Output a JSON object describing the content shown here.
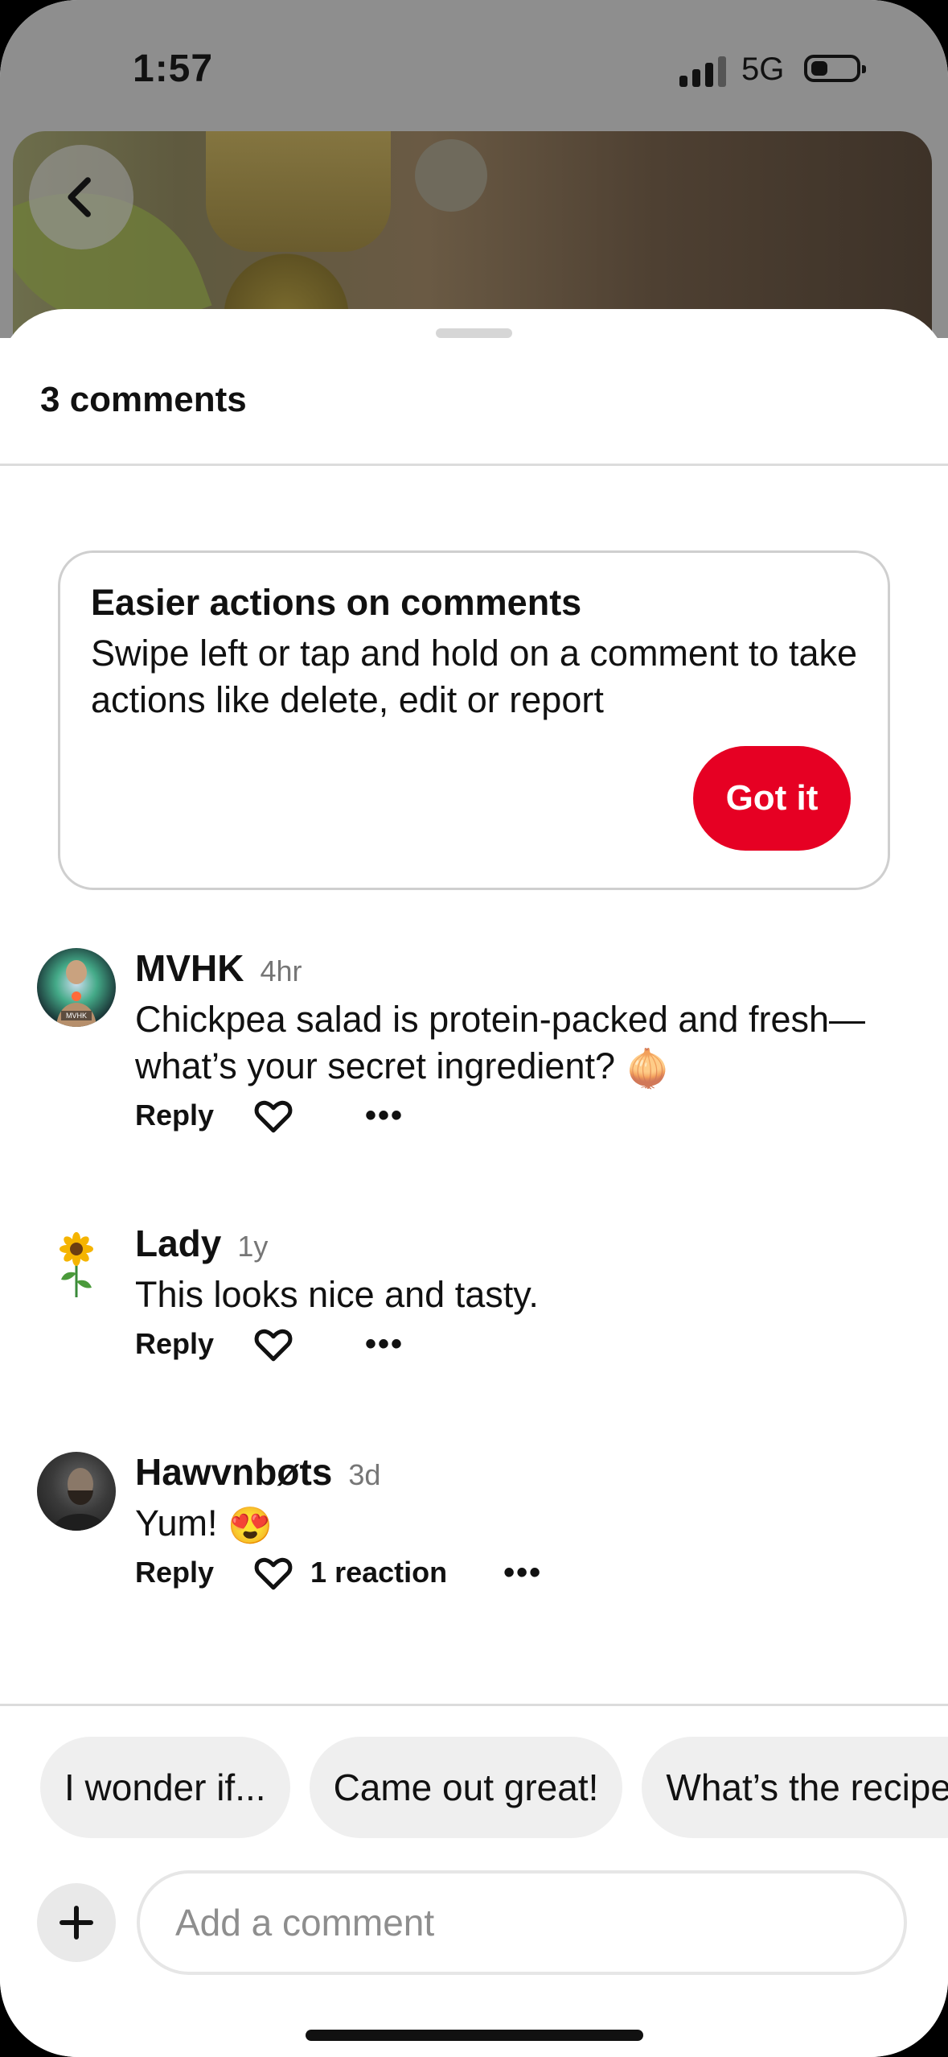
{
  "status_bar": {
    "time": "1:57",
    "network": "5G",
    "signal_icon": "cellular-signal-icon",
    "battery_icon": "battery-low-icon"
  },
  "pin": {
    "back_icon": "chevron-left-icon",
    "image_description_icon": "food-photo"
  },
  "sheet": {
    "title": "3 comments"
  },
  "tip": {
    "title": "Easier actions on comments",
    "body": "Swipe left or tap and hold on a comment to take actions like delete, edit or report",
    "button_label": "Got it"
  },
  "comments": [
    {
      "user": "MVHK",
      "time": "4hr",
      "text": "Chickpea salad is protein-packed and fresh—what’s your secret ingredient?",
      "emoji": "🧅",
      "reply_label": "Reply",
      "reactions": ""
    },
    {
      "user": "Lady",
      "time": "1y",
      "text": "This looks nice and tasty.",
      "emoji": "",
      "reply_label": "Reply",
      "reactions": ""
    },
    {
      "user": "Hawvnbøts",
      "time": "3d",
      "text": "Yum!",
      "emoji": "😍",
      "reply_label": "Reply",
      "reactions": "1 reaction"
    }
  ],
  "suggestions": [
    "I wonder if...",
    "Came out great!",
    "What’s the recipe?"
  ],
  "composer": {
    "placeholder": "Add a comment",
    "add_icon": "plus-icon"
  },
  "colors": {
    "accent": "#e60023",
    "chip_bg": "#efefef",
    "muted_text": "#767676"
  }
}
